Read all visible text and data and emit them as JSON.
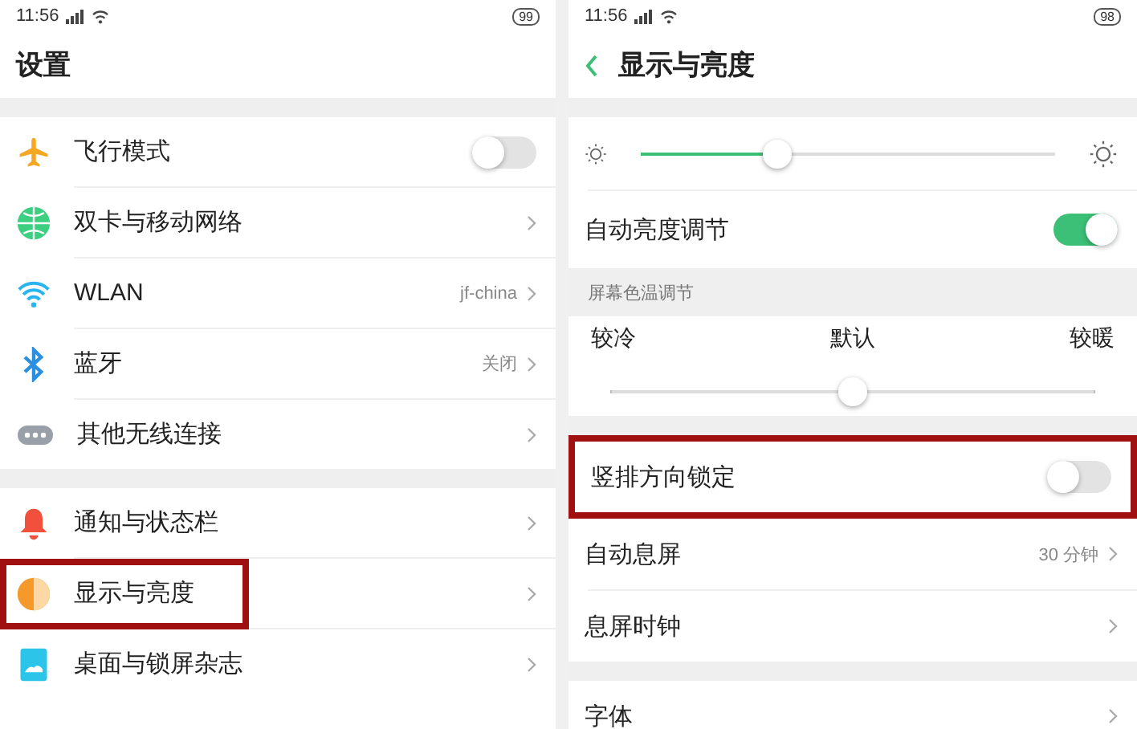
{
  "left_screen": {
    "status_bar": {
      "time": "11:56",
      "battery": "99"
    },
    "title": "设置",
    "items": [
      {
        "kind": "gap"
      },
      {
        "kind": "toggle",
        "label": "飞行模式",
        "on": false,
        "highlighted": false
      },
      {
        "kind": "link",
        "label": "双卡与移动网络",
        "highlighted": false
      },
      {
        "kind": "link",
        "label": "WLAN",
        "value": "jf-china",
        "highlighted": false
      },
      {
        "kind": "link",
        "label": "蓝牙",
        "value": "关闭",
        "highlighted": false
      },
      {
        "kind": "link",
        "label": "其他无线连接",
        "highlighted": false
      },
      {
        "kind": "gap"
      },
      {
        "kind": "link",
        "label": "通知与状态栏",
        "highlighted": false
      },
      {
        "kind": "link",
        "label": "显示与亮度",
        "highlighted": true
      },
      {
        "kind": "link",
        "label": "桌面与锁屏杂志",
        "highlighted": false
      }
    ]
  },
  "right_screen": {
    "status_bar": {
      "time": "11:56",
      "battery": "98"
    },
    "title": "显示与亮度",
    "items": [
      {
        "kind": "gap"
      },
      {
        "kind": "slider",
        "level": 0.33
      },
      {
        "kind": "toggle",
        "label": "自动亮度调节",
        "on": true,
        "highlighted": false
      },
      {
        "kind": "header",
        "label": "屏幕色温调节"
      },
      {
        "kind": "scale",
        "labels": [
          "较冷",
          "默认",
          "较暖"
        ],
        "level": 0.5
      },
      {
        "kind": "gap"
      },
      {
        "kind": "toggle",
        "label": "竖排方向锁定",
        "on": false,
        "highlighted": true
      },
      {
        "kind": "link",
        "label": "自动息屏",
        "value": "30 分钟",
        "highlighted": false
      },
      {
        "kind": "link",
        "label": "息屏时钟",
        "highlighted": false
      },
      {
        "kind": "gap"
      },
      {
        "kind": "link",
        "label": "字体",
        "highlighted": false
      }
    ]
  }
}
